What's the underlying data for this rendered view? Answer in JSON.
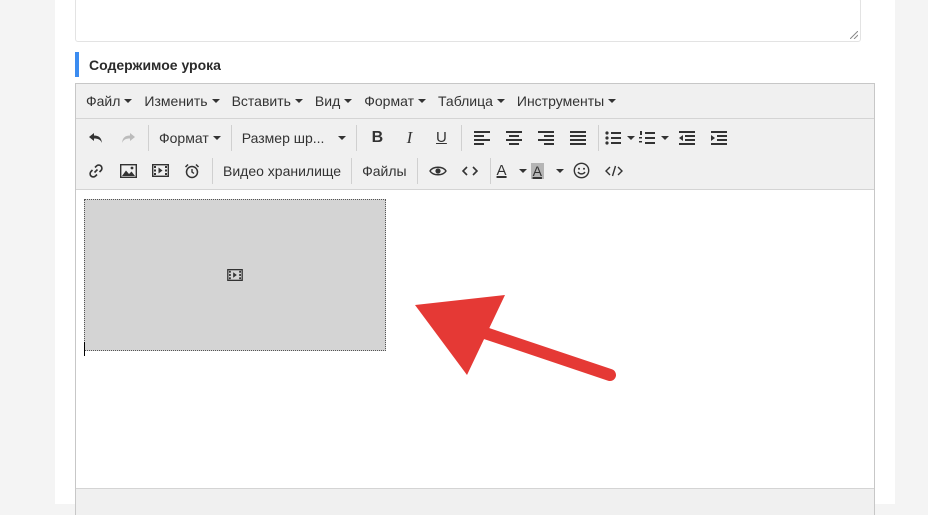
{
  "section": {
    "title": "Содержимое урока"
  },
  "menubar": {
    "items": [
      "Файл",
      "Изменить",
      "Вставить",
      "Вид",
      "Формат",
      "Таблица",
      "Инструменты"
    ]
  },
  "toolbar": {
    "format_label": "Формат",
    "font_size_label": "Размер шр...",
    "video_storage": "Видео хранилище",
    "files": "Файлы",
    "icons_row1": [
      "undo-icon",
      "redo-icon",
      "bold-icon",
      "italic-icon",
      "underline-icon",
      "align-left-icon",
      "align-center-icon",
      "align-right-icon",
      "align-justify-icon",
      "bullet-list-icon",
      "numbered-list-icon",
      "outdent-icon",
      "indent-icon"
    ],
    "icons_row2": [
      "link-icon",
      "image-icon",
      "media-icon",
      "alarm-clock-icon",
      "preview-icon",
      "code-icon",
      "text-color-icon",
      "background-color-icon",
      "emoticons-icon",
      "source-code-icon"
    ]
  },
  "colors": {
    "accent": "#3b8cf0",
    "arrow": "#e53935",
    "placeholder_bg": "#d4d4d4"
  }
}
